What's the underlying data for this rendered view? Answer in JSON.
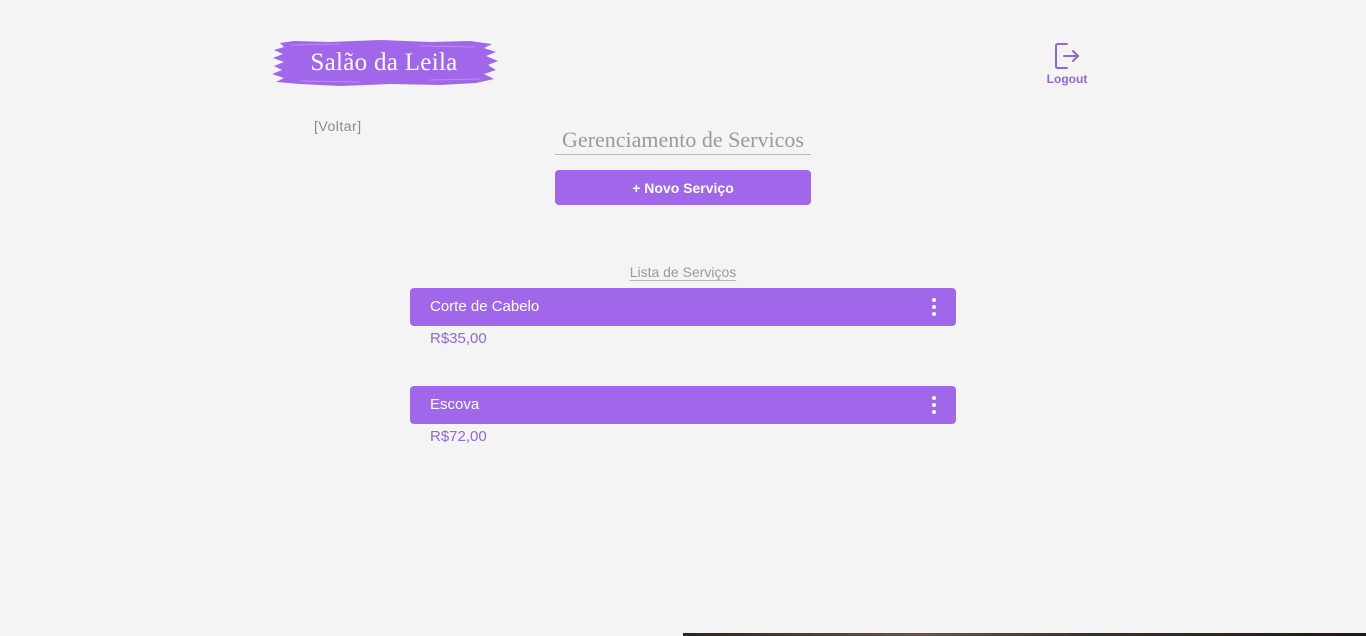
{
  "header": {
    "logo_text": "Salão da Leila",
    "logout_label": "Logout"
  },
  "nav": {
    "back_label": "[Voltar]"
  },
  "main": {
    "title": "Gerenciamento de Servicos",
    "new_button_label": "+ Novo Serviço",
    "list_title": "Lista de Serviços",
    "services": [
      {
        "name": "Corte de Cabelo",
        "price": "R$35,00"
      },
      {
        "name": "Escova",
        "price": "R$72,00"
      }
    ]
  },
  "colors": {
    "accent": "#a067ea",
    "accent_text": "#9266d6",
    "background": "#f4f4f4",
    "muted_text": "#9a9a9a"
  },
  "icons": {
    "logout": "logout-icon",
    "menu": "kebab-menu-icon"
  }
}
